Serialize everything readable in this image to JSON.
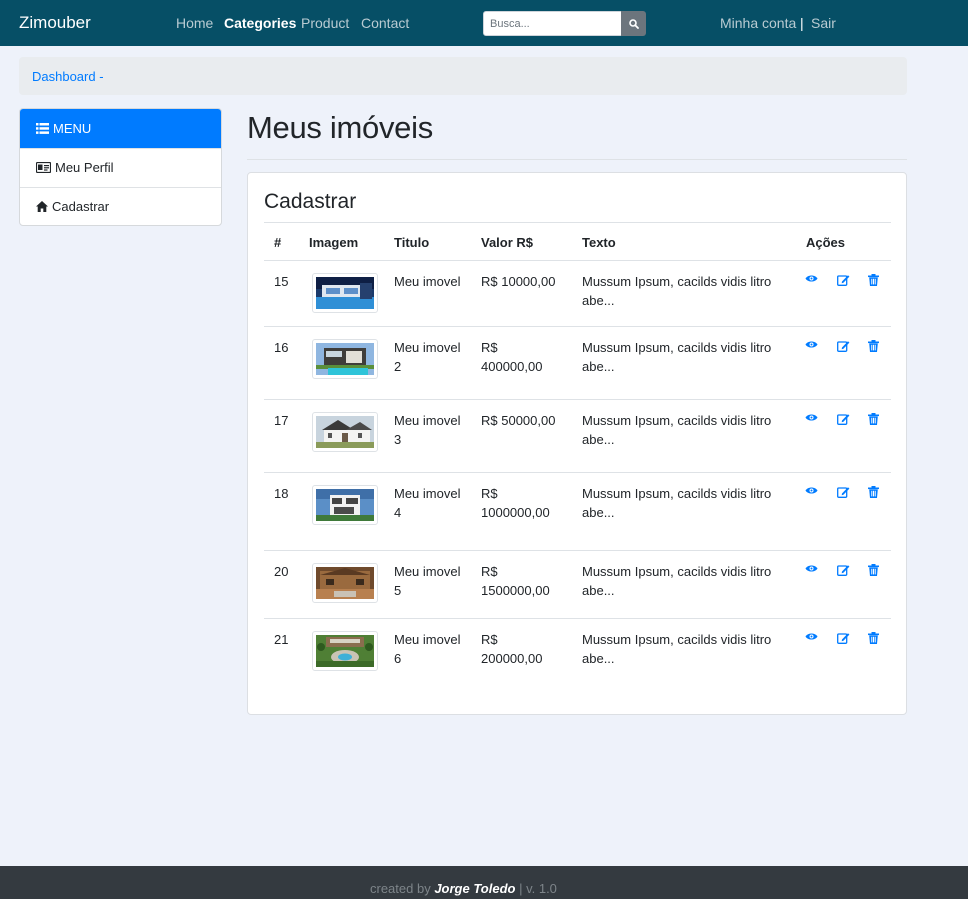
{
  "navbar": {
    "brand": "Zimouber",
    "links": [
      {
        "label": "Home",
        "active": false
      },
      {
        "label": "Categories",
        "active": true
      },
      {
        "label": "Product",
        "active": false
      },
      {
        "label": "Contact",
        "active": false
      }
    ],
    "search_placeholder": "Busca...",
    "search_icon": "search-icon",
    "account_label": "Minha conta",
    "separator": "|",
    "logout_label": "Sair"
  },
  "breadcrumb": {
    "label": "Dashboard -"
  },
  "sidebar": {
    "header": {
      "label": "MENU",
      "icon": "list-icon"
    },
    "items": [
      {
        "label": "Meu Perfil",
        "icon": "id-card-icon"
      },
      {
        "label": "Cadastrar",
        "icon": "home-icon"
      }
    ]
  },
  "page": {
    "title": "Meus imóveis"
  },
  "card": {
    "title": "Cadastrar",
    "columns": [
      "#",
      "Imagem",
      "Titulo",
      "Valor R$",
      "Texto",
      "Ações"
    ],
    "action_icons": [
      "eye-icon",
      "edit-icon",
      "trash-icon"
    ],
    "accent_color": "#007bff",
    "rows": [
      {
        "id": "15",
        "titulo": [
          "Meu imovel"
        ],
        "valor": [
          "R$ 10000,00"
        ],
        "texto": [
          "Mussum Ipsum, cacilds vidis litro",
          "abe..."
        ],
        "image": "pool-villa"
      },
      {
        "id": "16",
        "titulo": [
          "Meu imovel",
          "2"
        ],
        "valor": [
          "R$",
          "400000,00"
        ],
        "texto": [
          "Mussum Ipsum, cacilds vidis litro",
          "abe..."
        ],
        "image": "modern-house-pool"
      },
      {
        "id": "17",
        "titulo": [
          "Meu imovel",
          "3"
        ],
        "valor": [
          "R$ 50000,00"
        ],
        "texto": [
          "Mussum Ipsum, cacilds vidis litro",
          "abe..."
        ],
        "image": "white-farmhouse"
      },
      {
        "id": "18",
        "titulo": [
          "Meu imovel",
          "4"
        ],
        "valor": [
          "R$",
          "1000000,00"
        ],
        "texto": [
          "Mussum Ipsum, cacilds vidis litro",
          "abe..."
        ],
        "image": "white-cube-house"
      },
      {
        "id": "20",
        "titulo": [
          "Meu imovel",
          "5"
        ],
        "valor": [
          "R$",
          "1500000,00"
        ],
        "texto": [
          "Mussum Ipsum, cacilds vidis litro",
          "abe..."
        ],
        "image": "stone-villa"
      },
      {
        "id": "21",
        "titulo": [
          "Meu imovel",
          "6"
        ],
        "valor": [
          "R$",
          "200000,00"
        ],
        "texto": [
          "Mussum Ipsum, cacilds vidis litro",
          "abe..."
        ],
        "image": "garden-estate"
      }
    ]
  },
  "footer": {
    "prefix": "created by",
    "author": "Jorge Toledo",
    "suffix": "| v. 1.0"
  },
  "colors": {
    "navbar": "#064f66",
    "primary": "#007bff",
    "footer": "#343a40",
    "page_bg": "#eef2fa"
  }
}
